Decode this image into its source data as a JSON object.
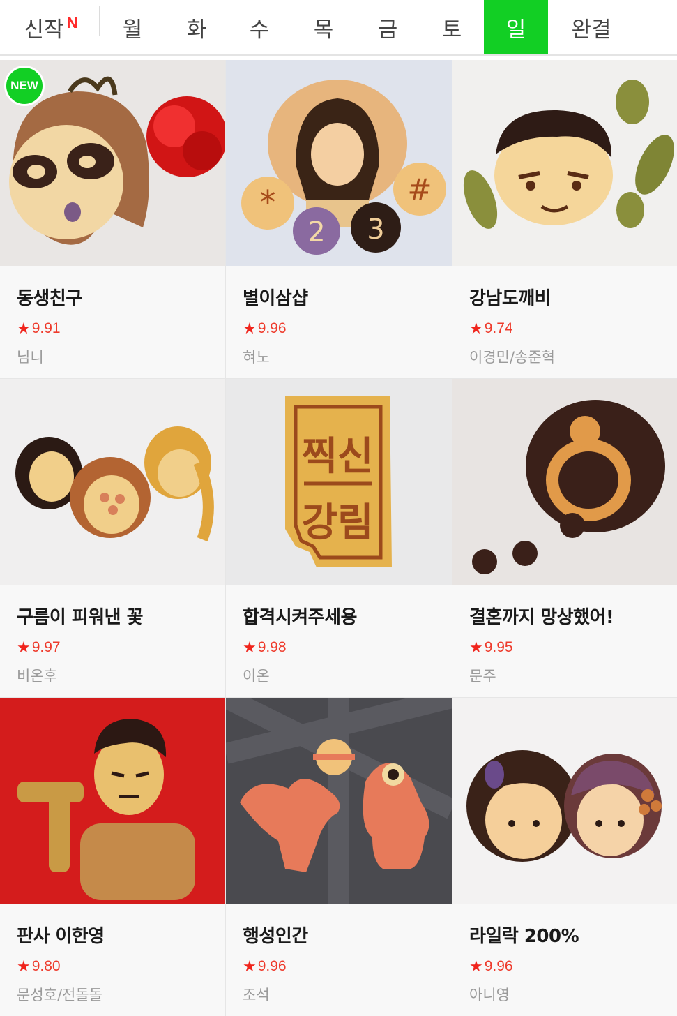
{
  "tabs": {
    "new_label": "신작",
    "new_mark": "N",
    "days": [
      "월",
      "화",
      "수",
      "목",
      "금",
      "토",
      "일"
    ],
    "active_day": "일",
    "completed": "완결"
  },
  "badge": {
    "new": "NEW"
  },
  "rating_star": "★",
  "accent_color": "#12cf24",
  "rating_color": "#ee3b2c",
  "webtoons": [
    {
      "title": "동생친구",
      "rating": "9.91",
      "author": "님니",
      "is_new": true
    },
    {
      "title": "별이삼샵",
      "rating": "9.96",
      "author": "혀노"
    },
    {
      "title": "강남도깨비",
      "rating": "9.74",
      "author": "이경민/송준혁"
    },
    {
      "title": "구름이 피워낸 꽃",
      "rating": "9.97",
      "author": "비온후"
    },
    {
      "title": "합격시켜주세용",
      "rating": "9.98",
      "author": "이온"
    },
    {
      "title": "결혼까지 망상했어!",
      "rating": "9.95",
      "author": "문주"
    },
    {
      "title": "판사 이한영",
      "rating": "9.80",
      "author": "문성호/전돌돌"
    },
    {
      "title": "행성인간",
      "rating": "9.96",
      "author": "조석"
    },
    {
      "title": "라일락 200%",
      "rating": "9.96",
      "author": "아니영"
    }
  ],
  "cookie_texts": {
    "sign_top": "찍신",
    "sign_bottom": "강림",
    "coin_2": "2",
    "coin_3": "3",
    "coin_star": "*",
    "coin_hash": "#"
  }
}
